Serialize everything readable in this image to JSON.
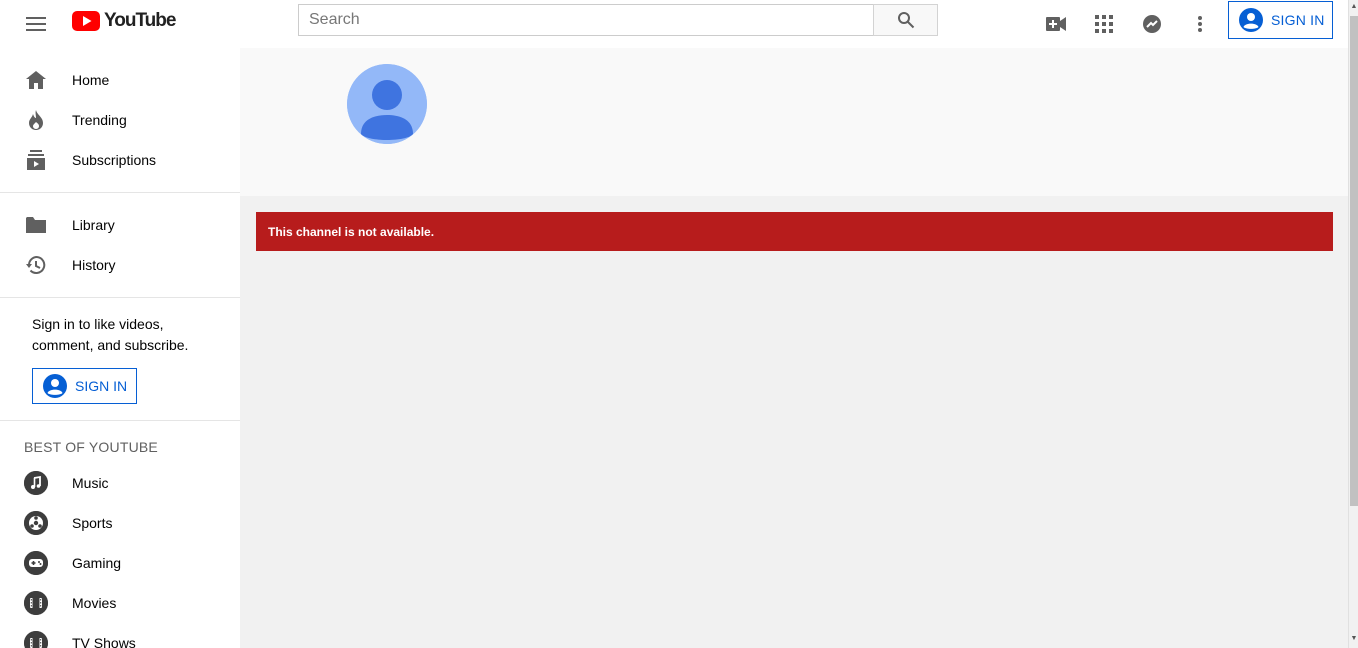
{
  "header": {
    "logo_text": "YouTube",
    "search_placeholder": "Search",
    "signin_label": "SIGN IN"
  },
  "sidebar": {
    "primary": [
      {
        "label": "Home",
        "icon": "home-icon"
      },
      {
        "label": "Trending",
        "icon": "flame-icon"
      },
      {
        "label": "Subscriptions",
        "icon": "subscriptions-icon"
      }
    ],
    "secondary": [
      {
        "label": "Library",
        "icon": "folder-icon"
      },
      {
        "label": "History",
        "icon": "history-icon"
      }
    ],
    "promo_text": "Sign in to like videos, comment, and subscribe.",
    "signin_label": "SIGN IN",
    "best_title": "BEST OF YOUTUBE",
    "best": [
      {
        "label": "Music",
        "icon": "music-icon"
      },
      {
        "label": "Sports",
        "icon": "sports-icon"
      },
      {
        "label": "Gaming",
        "icon": "gaming-icon"
      },
      {
        "label": "Movies",
        "icon": "movies-icon"
      },
      {
        "label": "TV Shows",
        "icon": "tv-shows-icon"
      }
    ]
  },
  "main": {
    "error_message": "This channel is not available."
  },
  "colors": {
    "brand_red": "#ff0000",
    "accent_blue": "#065fd4",
    "error_red": "#b71c1c",
    "avatar_bg": "#93b8f8",
    "avatar_fg": "#3f74e0"
  }
}
